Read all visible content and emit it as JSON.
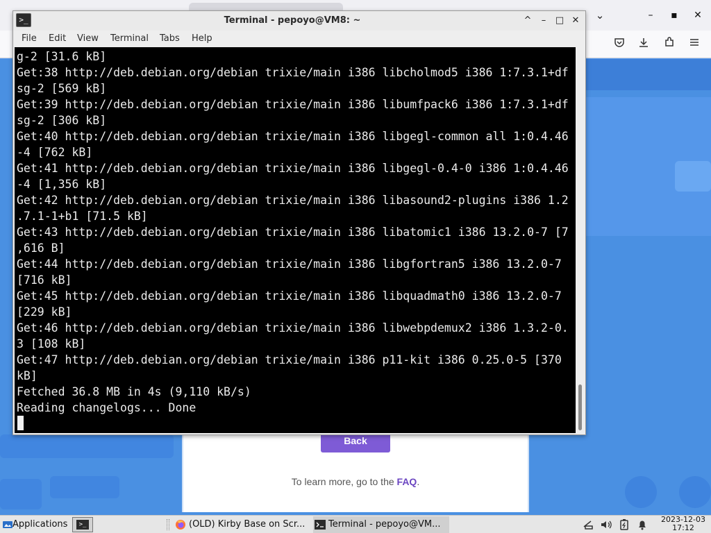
{
  "browser": {
    "dropdown_icon": "chevron-down-icon",
    "window_controls": {
      "minimize": "–",
      "maximize": "▪",
      "close": "✕"
    },
    "toolbar_icons": [
      "pocket-icon",
      "download-icon",
      "extensions-icon",
      "hamburger-menu-icon"
    ],
    "page": {
      "back_label": "Back",
      "faq_prefix": "To learn more, go to the ",
      "faq_link": "FAQ",
      "faq_suffix": "."
    }
  },
  "terminal": {
    "title": "Terminal - pepoyo@VM8: ~",
    "titlebar_buttons": {
      "shade": "^",
      "minimize": "–",
      "maximize": "□",
      "close": "✕"
    },
    "menu": [
      "File",
      "Edit",
      "View",
      "Terminal",
      "Tabs",
      "Help"
    ],
    "lines": [
      "g-2 [31.6 kB]",
      "Get:38 http://deb.debian.org/debian trixie/main i386 libcholmod5 i386 1:7.3.1+df",
      "sg-2 [569 kB]",
      "Get:39 http://deb.debian.org/debian trixie/main i386 libumfpack6 i386 1:7.3.1+df",
      "sg-2 [306 kB]",
      "Get:40 http://deb.debian.org/debian trixie/main i386 libgegl-common all 1:0.4.46",
      "-4 [762 kB]",
      "Get:41 http://deb.debian.org/debian trixie/main i386 libgegl-0.4-0 i386 1:0.4.46",
      "-4 [1,356 kB]",
      "Get:42 http://deb.debian.org/debian trixie/main i386 libasound2-plugins i386 1.2",
      ".7.1-1+b1 [71.5 kB]",
      "Get:43 http://deb.debian.org/debian trixie/main i386 libatomic1 i386 13.2.0-7 [7",
      ",616 B]",
      "Get:44 http://deb.debian.org/debian trixie/main i386 libgfortran5 i386 13.2.0-7",
      "[716 kB]",
      "Get:45 http://deb.debian.org/debian trixie/main i386 libquadmath0 i386 13.2.0-7",
      "[229 kB]",
      "Get:46 http://deb.debian.org/debian trixie/main i386 libwebpdemux2 i386 1.3.2-0.",
      "3 [108 kB]",
      "Get:47 http://deb.debian.org/debian trixie/main i386 p11-kit i386 0.25.0-5 [370",
      "kB]",
      "Fetched 36.8 MB in 4s (9,110 kB/s)",
      "Reading changelogs... Done"
    ]
  },
  "taskbar": {
    "applications_label": "Applications",
    "tasks": [
      {
        "label": "(OLD) Kirby Base on Scr...",
        "icon": "firefox-icon"
      },
      {
        "label": "Terminal - pepoyo@VM...",
        "icon": "terminal-icon"
      }
    ],
    "tray_icons": [
      "network-icon",
      "volume-icon",
      "battery-icon",
      "notification-bell-icon"
    ],
    "clock": {
      "date": "2023-12-03",
      "time": "17:12"
    }
  }
}
